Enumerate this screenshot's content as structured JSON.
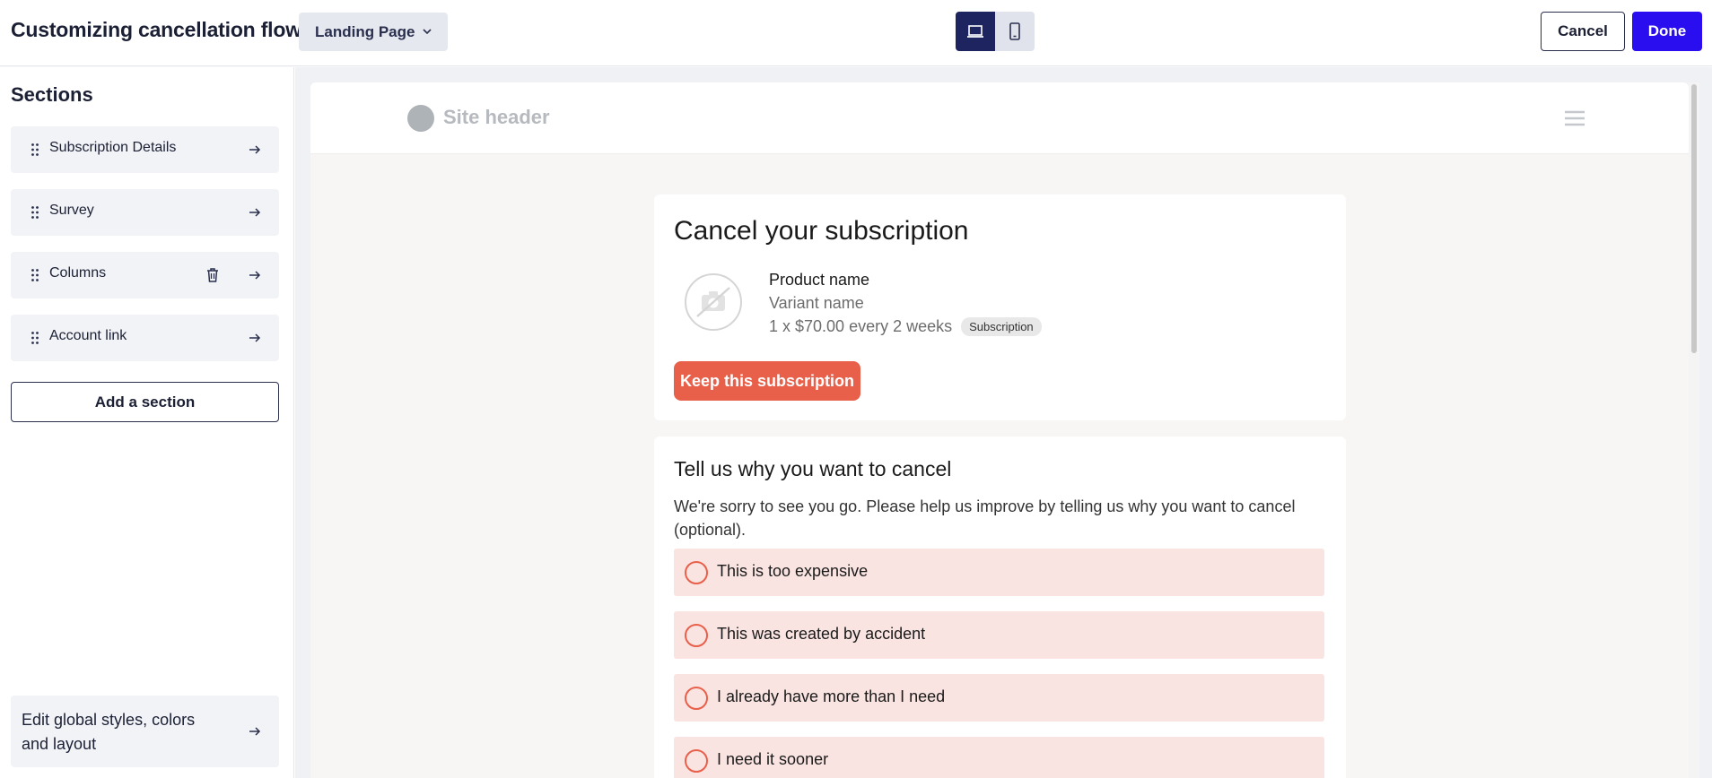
{
  "header": {
    "title": "Customizing cancellation flow",
    "page_select": {
      "value": "Landing Page"
    },
    "devices": [
      {
        "name": "desktop",
        "icon": "laptop-icon",
        "active": true
      },
      {
        "name": "mobile",
        "icon": "phone-icon",
        "active": false
      }
    ],
    "cancel_label": "Cancel",
    "done_label": "Done"
  },
  "sidebar": {
    "heading": "Sections",
    "items": [
      {
        "label": "Subscription Details",
        "deletable": false
      },
      {
        "label": "Survey",
        "deletable": false
      },
      {
        "label": "Columns",
        "deletable": true
      },
      {
        "label": "Account link",
        "deletable": false
      }
    ],
    "add_section_label": "Add a section",
    "global_styles_label": "Edit global styles, colors and layout"
  },
  "preview": {
    "site_header": {
      "title": "Site header"
    },
    "subscription_card": {
      "title": "Cancel your subscription",
      "product_name": "Product name",
      "variant_name": "Variant name",
      "price_line": "1 x $70.00 every 2 weeks",
      "badge": "Subscription",
      "keep_button": "Keep this subscription"
    },
    "survey_card": {
      "title": "Tell us why you want to cancel",
      "description": "We're sorry to see you go. Please help us improve by telling us why you want to cancel (optional).",
      "options": [
        "This is too expensive",
        "This was created by accident",
        "I already have more than I need",
        "I need it sooner"
      ]
    }
  },
  "colors": {
    "primary_button": "#2a0ef0",
    "device_active": "#1e2460",
    "accent": "#e8604a",
    "option_bg": "#fae4e1"
  }
}
